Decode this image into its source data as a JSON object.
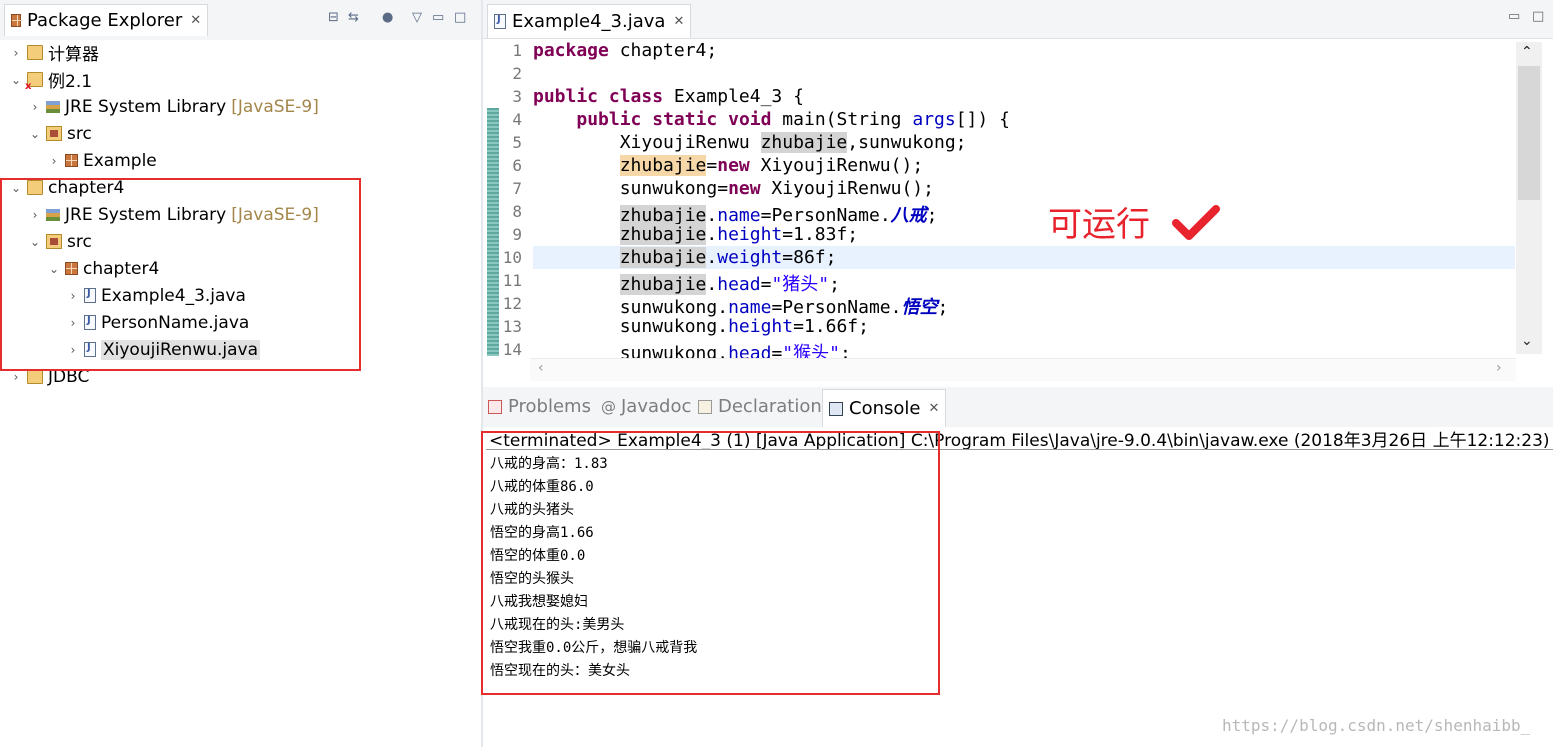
{
  "package_explorer": {
    "title": "Package Explorer",
    "tree": [
      {
        "label": "计算器",
        "expanded": false
      },
      {
        "label": "例2.1",
        "expanded": true
      },
      {
        "label": "JRE System Library",
        "suffix": "[JavaSE-9]"
      },
      {
        "label": "src",
        "expanded": true
      },
      {
        "label": "Example",
        "expanded": false
      },
      {
        "label": "chapter4",
        "expanded": true
      },
      {
        "label": "JRE System Library",
        "suffix": "[JavaSE-9]"
      },
      {
        "label": "src",
        "expanded": true
      },
      {
        "label": "chapter4",
        "expanded": true
      },
      {
        "label": "Example4_3.java"
      },
      {
        "label": "PersonName.java"
      },
      {
        "label": "XiyoujiRenwu.java",
        "selected": true
      },
      {
        "label": "JDBC",
        "expanded": false
      }
    ]
  },
  "editor": {
    "tab_title": "Example4_3.java",
    "line_numbers": [
      "1",
      "2",
      "3",
      "4",
      "5",
      "6",
      "7",
      "8",
      "9",
      "10",
      "11",
      "12",
      "13",
      "14"
    ],
    "annotation": "可运行"
  },
  "bottom_panel": {
    "tabs": {
      "problems": "Problems",
      "javadoc": "Javadoc",
      "declaration": "Declaration",
      "console": "Console"
    },
    "console_header": "<terminated> Example4_3 (1) [Java Application] C:\\Program Files\\Java\\jre-9.0.4\\bin\\javaw.exe (2018年3月26日 上午12:12:23)",
    "output": [
      "八戒的身高：1.83",
      "八戒的体重86.0",
      "八戒的头猪头",
      "悟空的身高1.66",
      "悟空的体重0.0",
      "悟空的头猴头",
      "八戒我想娶媳妇",
      "八戒现在的头:美男头",
      "悟空我重0.0公斤，想骗八戒背我",
      "悟空现在的头：美女头"
    ]
  },
  "watermark": "https://blog.csdn.net/shenhaibb_",
  "colors": {
    "highlight_box": "#e52d2d",
    "keyword": "#7f0055",
    "field": "#0000c0",
    "string": "#2a00ff"
  }
}
